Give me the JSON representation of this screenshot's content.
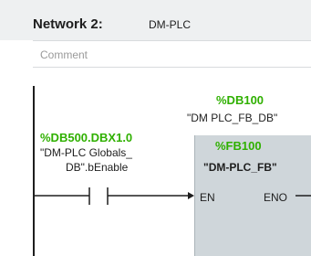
{
  "network": {
    "title": "Network 2:",
    "name": "DM-PLC",
    "comment_placeholder": "Comment"
  },
  "contact": {
    "address": "%DB500.DBX1.0",
    "symbol_line1": "\"DM-PLC Globals_",
    "symbol_line2": "DB\".bEnable"
  },
  "instance_db": {
    "address": "%DB100",
    "symbol": "\"DM PLC_FB_DB\""
  },
  "function_block": {
    "address": "%FB100",
    "name": "\"DM-PLC_FB\"",
    "pins": {
      "en": "EN",
      "eno": "ENO"
    }
  },
  "colors": {
    "address_green": "#2fb000",
    "header_bg": "#eef0f1",
    "block_bg": "#cfd6da"
  }
}
